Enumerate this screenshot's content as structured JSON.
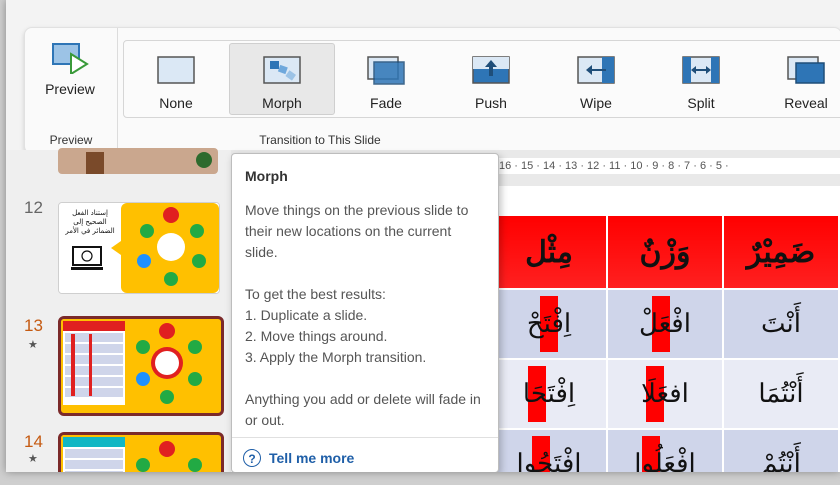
{
  "ribbon": {
    "preview": {
      "button_label": "Preview",
      "group_label": "Preview"
    },
    "transition_group_label": "Transition to This Slide",
    "transitions": [
      {
        "name": "None",
        "icon": "none-transition-icon",
        "selected": false
      },
      {
        "name": "Morph",
        "icon": "morph-transition-icon",
        "selected": true
      },
      {
        "name": "Fade",
        "icon": "fade-transition-icon",
        "selected": false
      },
      {
        "name": "Push",
        "icon": "push-transition-icon",
        "selected": false
      },
      {
        "name": "Wipe",
        "icon": "wipe-transition-icon",
        "selected": false
      },
      {
        "name": "Split",
        "icon": "split-transition-icon",
        "selected": false
      },
      {
        "name": "Reveal",
        "icon": "reveal-transition-icon",
        "selected": false
      }
    ]
  },
  "slides": {
    "numbers": [
      "12",
      "13",
      "14"
    ],
    "star": "★",
    "slide12_text": "إستناد الفعل الصحيح إلى الضمائر في الأمر"
  },
  "ruler": {
    "text": "16 · 15 · 14 · 13 · 12 · 11 · 10 · 9 · 8 · 7 · 6 · 5 ·"
  },
  "table": {
    "headers": [
      "ضَمِيْرٌ",
      "وَزْنٌ",
      "مِثْل"
    ],
    "rows": [
      [
        "أَنْتَ",
        "افْعَلْ",
        "اِفْتَحْ"
      ],
      [
        "أَنْتُمَا",
        "افعَلَا",
        "اِفْتَحَا"
      ],
      [
        "أَنْتُمْ",
        "افْعَلُوا",
        "اِفْتَحُوا"
      ]
    ]
  },
  "tooltip": {
    "title": "Morph",
    "p1": "Move things on the previous slide to their new locations on the current slide.",
    "p2_intro": "To get the best results:",
    "step1": "1. Duplicate a slide.",
    "step2": "2. Move things around.",
    "step3": "3. Apply the Morph transition.",
    "p3": "Anything you add or delete will fade in or out.",
    "link": "Tell me more",
    "link_icon": "?"
  },
  "colors": {
    "accent_link": "#1f5fa8",
    "table_header": "#ff0000",
    "slide_border": "#7b2a2a",
    "slide_bg": "#ffc000"
  }
}
